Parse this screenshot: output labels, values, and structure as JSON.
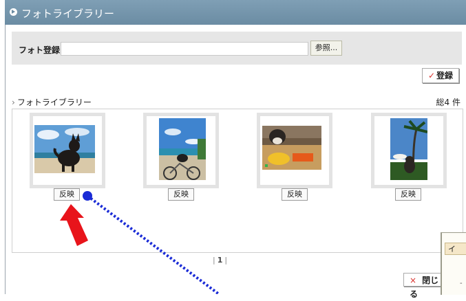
{
  "header": {
    "title": "フォトライブラリー"
  },
  "upload": {
    "label": "フォト登録",
    "input_value": "",
    "browse_label": "参照..."
  },
  "register_button": {
    "check": "✓",
    "label": "登録"
  },
  "library": {
    "section_title": "フォトライブラリー",
    "total": "総4 件"
  },
  "photos": [
    {
      "reflect_label": "反映"
    },
    {
      "reflect_label": "反映"
    },
    {
      "reflect_label": "反映"
    },
    {
      "reflect_label": "反映"
    }
  ],
  "pagination": {
    "current": "1"
  },
  "close_button": {
    "icon": "×",
    "label": "閉じる"
  },
  "overlay": {
    "header_char": "イ",
    "dash": "-"
  },
  "colors": {
    "titlebar": "#6b8ca3",
    "annotation_arrow": "#e8141b",
    "annotation_dots": "#1a2bd6"
  }
}
